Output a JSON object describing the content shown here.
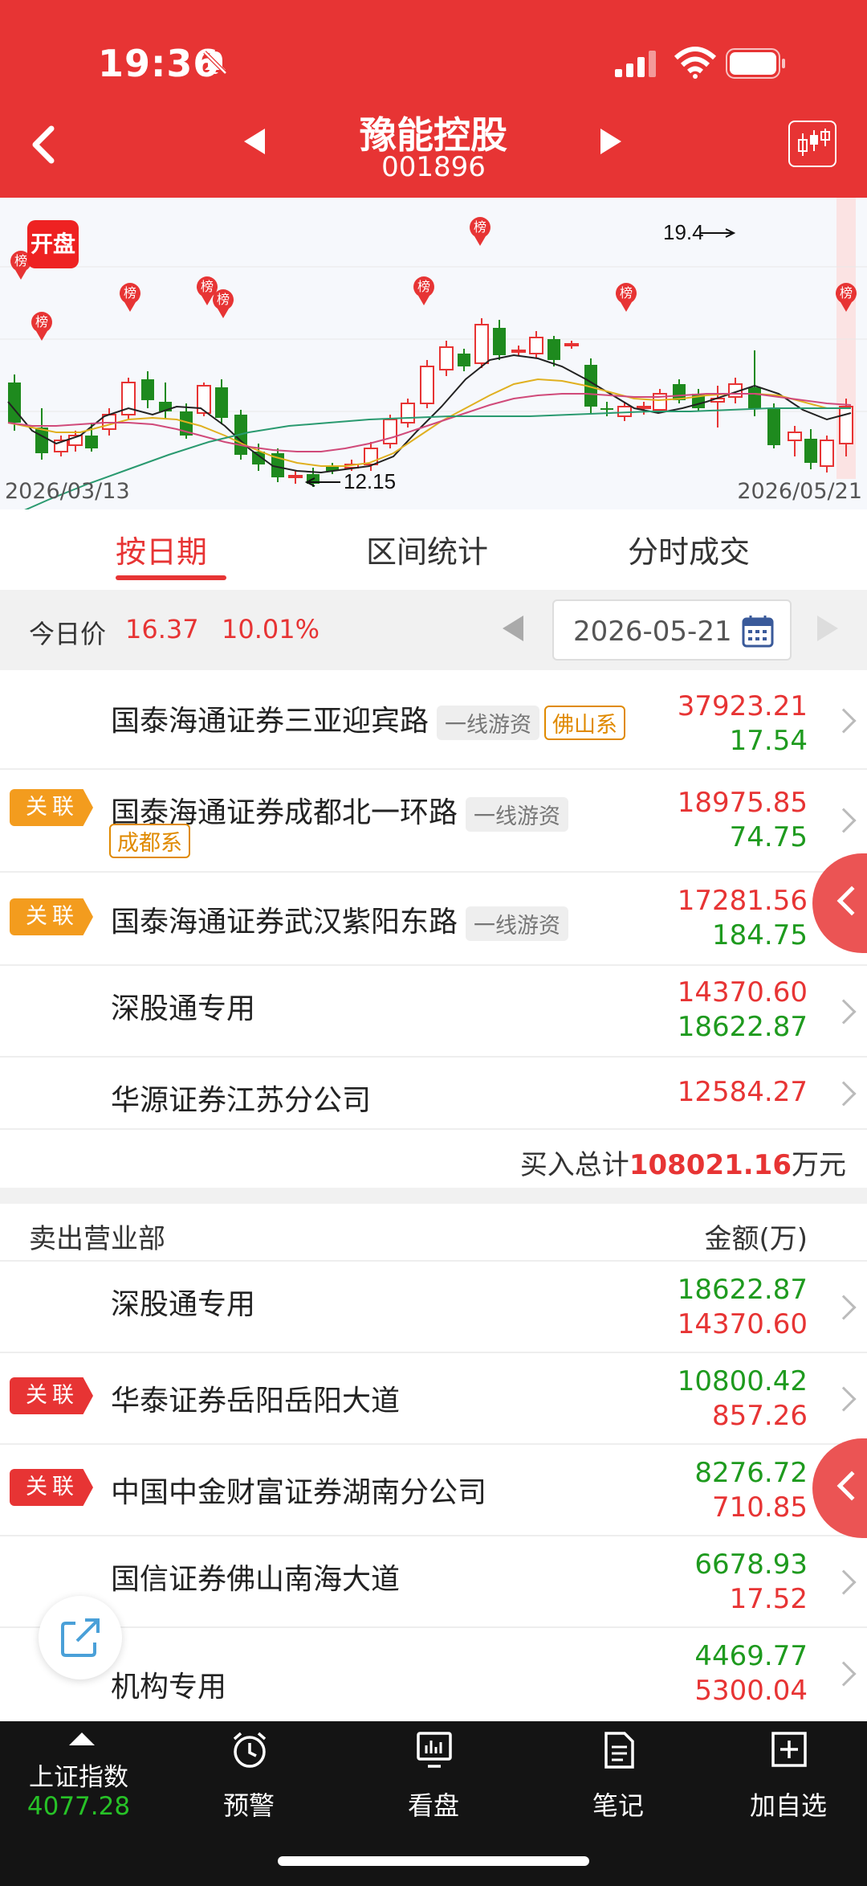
{
  "status": {
    "time": "19:36"
  },
  "header": {
    "title": "豫能控股",
    "code": "001896"
  },
  "chart": {
    "open_badge": "开盘",
    "date_start": "2026/03/13",
    "date_end": "2026/05/21",
    "high_annotation": "19.4",
    "low_annotation": "12.15",
    "marker_label": "榜"
  },
  "tabs": [
    {
      "label": "按日期",
      "active": true
    },
    {
      "label": "区间统计",
      "active": false
    },
    {
      "label": "分时成交",
      "active": false
    }
  ],
  "price_bar": {
    "label": "今日价",
    "price": "16.37",
    "change": "10.01%",
    "date": "2026-05-21"
  },
  "buy_rows": [
    {
      "name": "国泰海通证券三亚迎宾路",
      "tags": [
        "一线游资"
      ],
      "tags_orange": [
        "佛山系"
      ],
      "assoc": "",
      "buy": "37923.21",
      "sell": "17.54"
    },
    {
      "name": "国泰海通证券成都北一环路",
      "tags": [
        "一线游资"
      ],
      "tags_orange": [
        "成都系"
      ],
      "assoc": "关联",
      "buy": "18975.85",
      "sell": "74.75"
    },
    {
      "name": "国泰海通证券武汉紫阳东路",
      "tags": [
        "一线游资"
      ],
      "tags_orange": [],
      "assoc": "关联",
      "buy": "17281.56",
      "sell": "184.75"
    },
    {
      "name": "深股通专用",
      "tags": [],
      "tags_orange": [],
      "assoc": "",
      "buy": "14370.60",
      "sell": "18622.87"
    },
    {
      "name": "华源证券江苏分公司",
      "tags": [],
      "tags_orange": [],
      "assoc": "",
      "buy": "12584.27",
      "sell": ""
    }
  ],
  "buy_total": {
    "label": "买入总计",
    "value": "108021.16",
    "unit": "万元"
  },
  "sell_header": {
    "left": "卖出营业部",
    "right": "金额(万)"
  },
  "sell_rows": [
    {
      "name": "深股通专用",
      "assoc": "",
      "sell": "18622.87",
      "buy": "14370.60"
    },
    {
      "name": "华泰证券岳阳岳阳大道",
      "assoc": "关联",
      "sell": "10800.42",
      "buy": "857.26"
    },
    {
      "name": "中国中金财富证券湖南分公司",
      "assoc": "关联",
      "sell": "8276.72",
      "buy": "710.85"
    },
    {
      "name": "国信证券佛山南海大道",
      "assoc": "",
      "sell": "6678.93",
      "buy": "17.52"
    },
    {
      "name": "机构专用",
      "assoc": "",
      "sell": "4469.77",
      "buy": "5300.04"
    }
  ],
  "bottom_nav": {
    "index_name": "上证指数",
    "index_value": "4077.28",
    "items": [
      "预警",
      "看盘",
      "笔记",
      "加自选"
    ]
  },
  "colors": {
    "brand": "#e73434",
    "up": "#e73434",
    "down": "#1e9a1e",
    "tag_orange": "#e08a00"
  }
}
